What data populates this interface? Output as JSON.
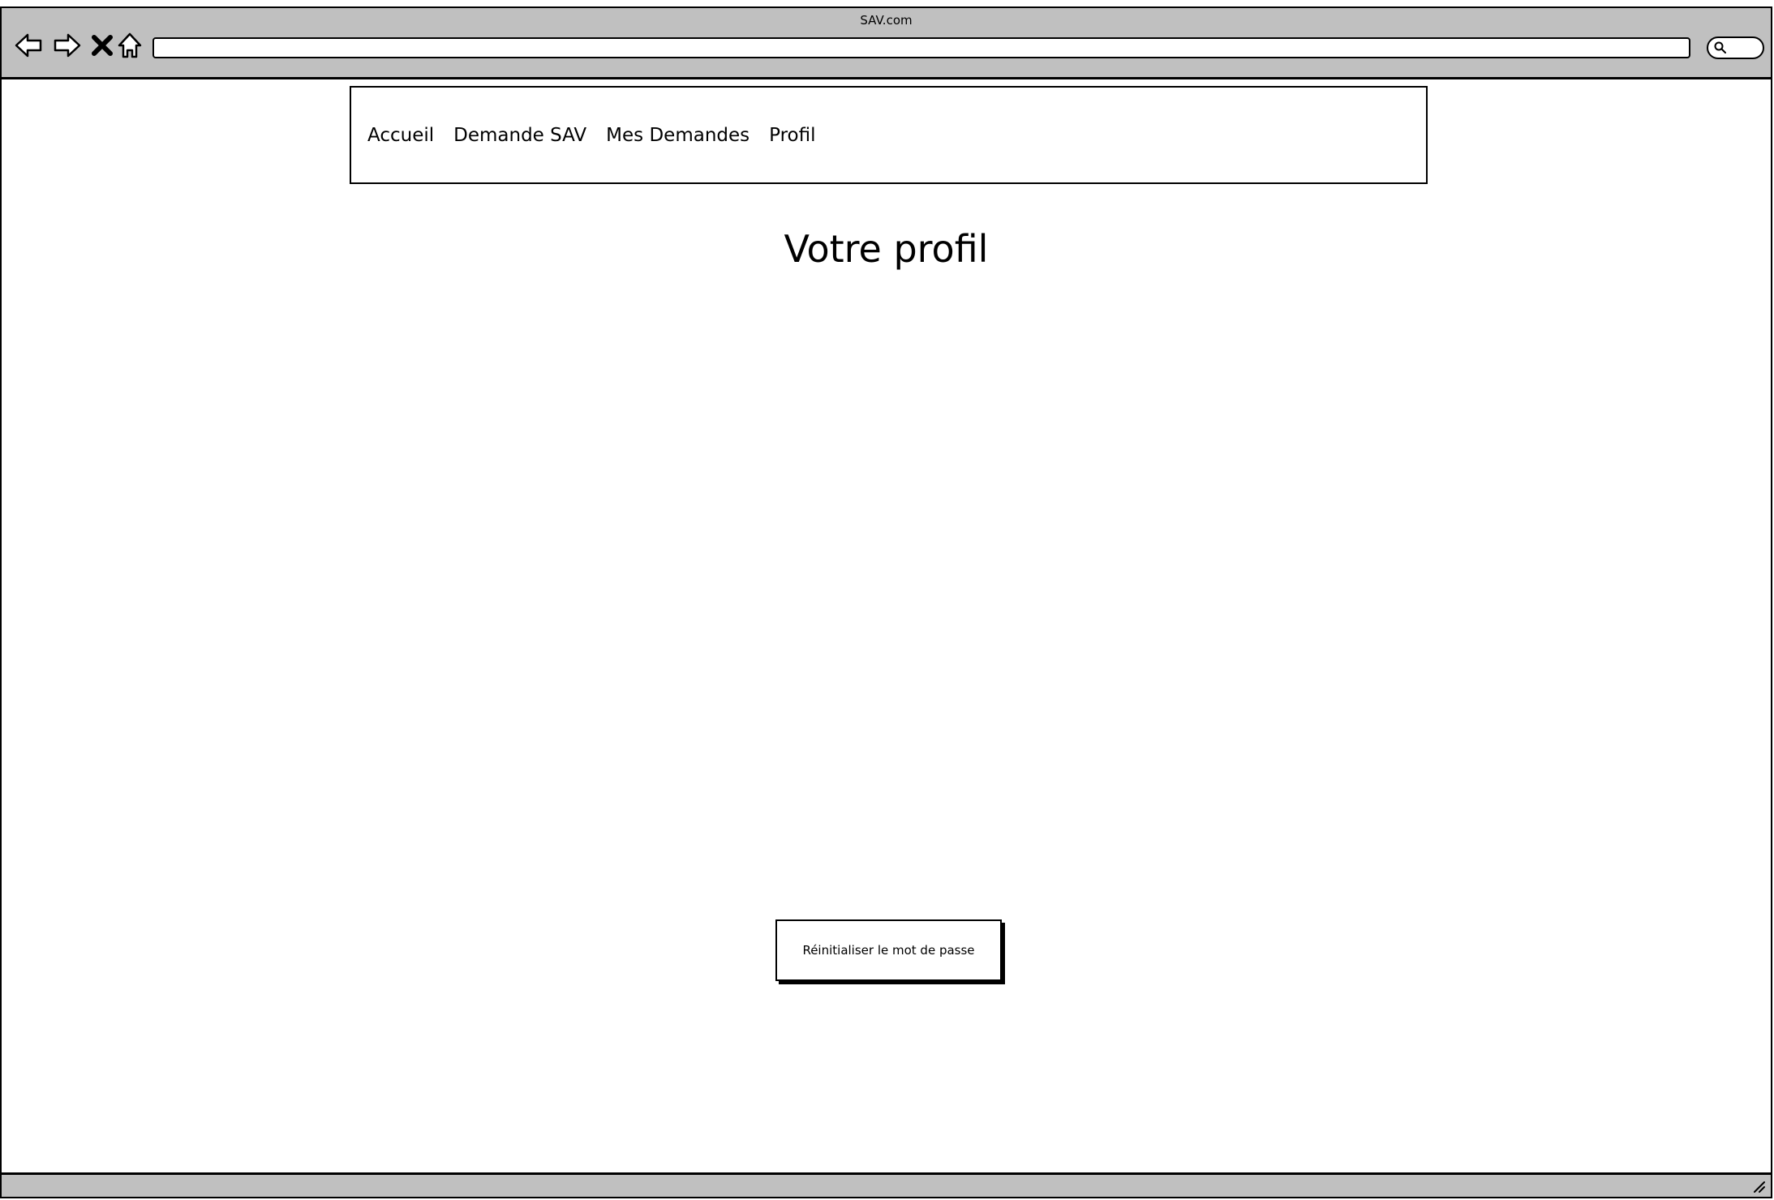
{
  "browser": {
    "title": "SAV.com",
    "icons": [
      "back-arrow-icon",
      "forward-arrow-icon",
      "close-icon",
      "home-icon",
      "search-icon",
      "resize-grip-icon"
    ],
    "url": ""
  },
  "nav": {
    "items": [
      {
        "label": "Accueil"
      },
      {
        "label": "Demande SAV"
      },
      {
        "label": "Mes Demandes"
      },
      {
        "label": "Profil"
      }
    ]
  },
  "main": {
    "title": "Votre profil",
    "reset_button_label": "Réinitialiser le mot de passe"
  }
}
